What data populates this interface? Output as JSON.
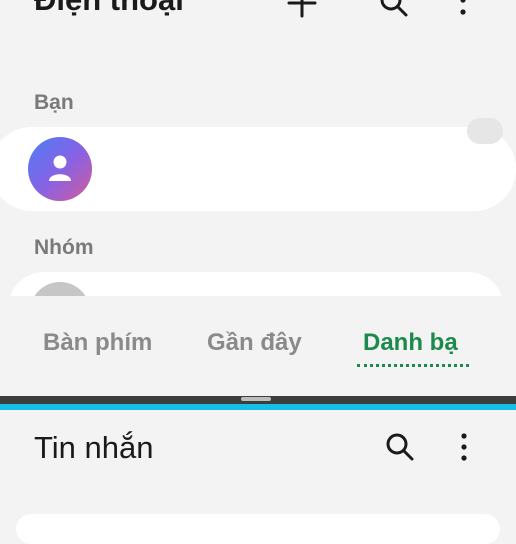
{
  "phone_app": {
    "title": "Điện thoại",
    "actions": [
      "add-icon",
      "search-icon",
      "more-vert-icon"
    ],
    "sections": [
      {
        "label": "Bạn"
      },
      {
        "label": "Nhóm"
      }
    ],
    "tabs": [
      {
        "label": "Bàn phím",
        "active": false
      },
      {
        "label": "Gần đây",
        "active": false
      },
      {
        "label": "Danh bạ",
        "active": true
      }
    ],
    "accent_color": "#1c8a4c"
  },
  "split_divider": {
    "color": "#14bfe8"
  },
  "messages_app": {
    "title": "Tin nhắn",
    "actions": [
      "search-icon",
      "more-vert-icon"
    ]
  }
}
